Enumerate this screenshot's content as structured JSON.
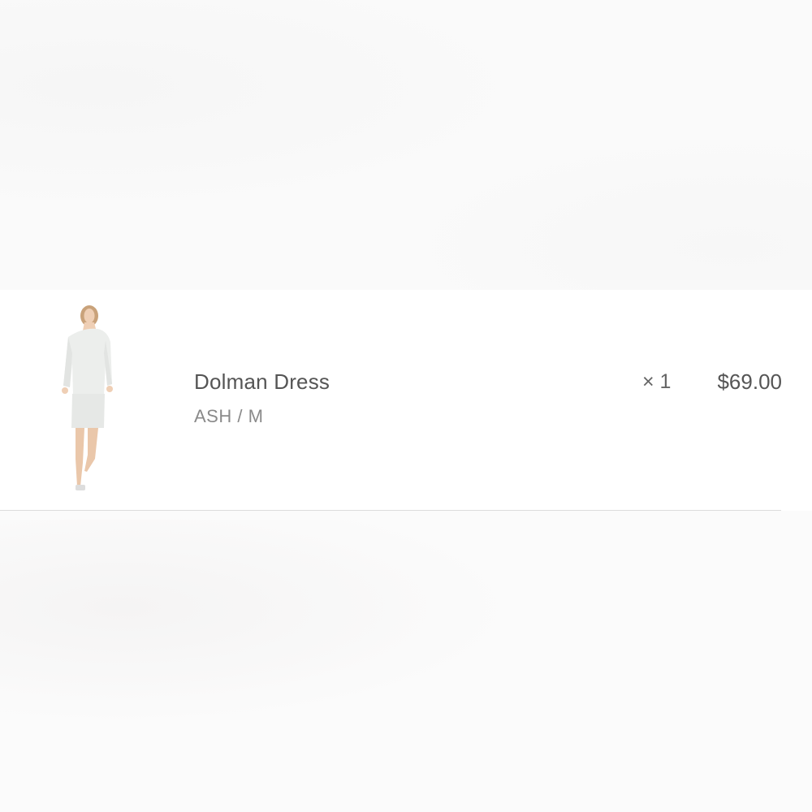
{
  "cart": {
    "line_items": [
      {
        "image_icon": "dolman-dress-product-photo",
        "name": "Dolman Dress",
        "variant": "ASH / M",
        "quantity": "× 1",
        "price": "$69.00"
      }
    ]
  },
  "colors": {
    "text_primary": "#555555",
    "text_secondary": "#8a8a8a",
    "divider": "#dcdcdc",
    "row_background": "#ffffff"
  }
}
